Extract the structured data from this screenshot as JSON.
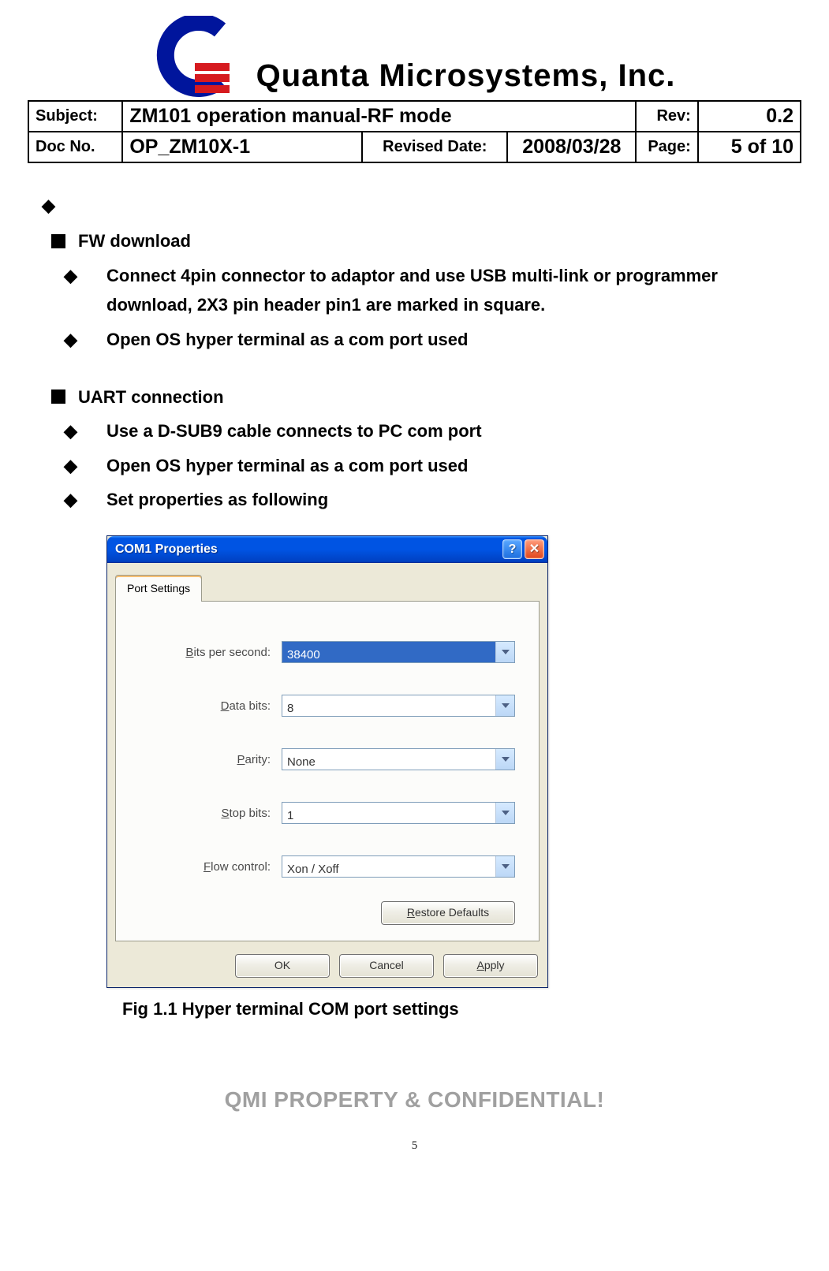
{
  "company_name": "Quanta Microsystems, Inc.",
  "header": {
    "subject_label": "Subject:",
    "subject_value": "ZM101 operation manual-RF mode",
    "rev_label": "Rev:",
    "rev_value": "0.2",
    "docno_label": "Doc No.",
    "docno_value": "OP_ZM10X-1",
    "revised_label": "Revised Date:",
    "revised_value": "2008/03/28",
    "page_label": "Page:",
    "page_value": "5 of 10"
  },
  "sections": {
    "fw_title": "FW download",
    "fw_items": [
      "Connect 4pin connector to adaptor and use USB multi-link or programmer download, 2X3 pin header pin1 are marked in square.",
      "Open OS hyper terminal as a com port used"
    ],
    "uart_title": "UART connection",
    "uart_items": [
      "Use a D-SUB9 cable connects to PC com port",
      "Open OS hyper terminal as a com port used",
      "Set properties as following"
    ]
  },
  "dialog": {
    "title": "COM1 Properties",
    "tab": "Port Settings",
    "fields": {
      "bits_label_pre": "B",
      "bits_label_rest": "its per second:",
      "bits_value": "38400",
      "data_label_pre": "D",
      "data_label_rest": "ata bits:",
      "data_value": "8",
      "parity_label_pre": "P",
      "parity_label_rest": "arity:",
      "parity_value": "None",
      "stop_label_pre": "S",
      "stop_label_rest": "top bits:",
      "stop_value": "1",
      "flow_label_pre": "F",
      "flow_label_rest": "low control:",
      "flow_value": "Xon / Xoff"
    },
    "buttons": {
      "restore_pre": "R",
      "restore_rest": "estore Defaults",
      "ok": "OK",
      "cancel": "Cancel",
      "apply_pre": "A",
      "apply_rest": "pply"
    }
  },
  "figure_caption": "Fig 1.1 Hyper terminal COM port settings",
  "footer": "QMI PROPERTY & CONFIDENTIAL!",
  "page_number": "5"
}
